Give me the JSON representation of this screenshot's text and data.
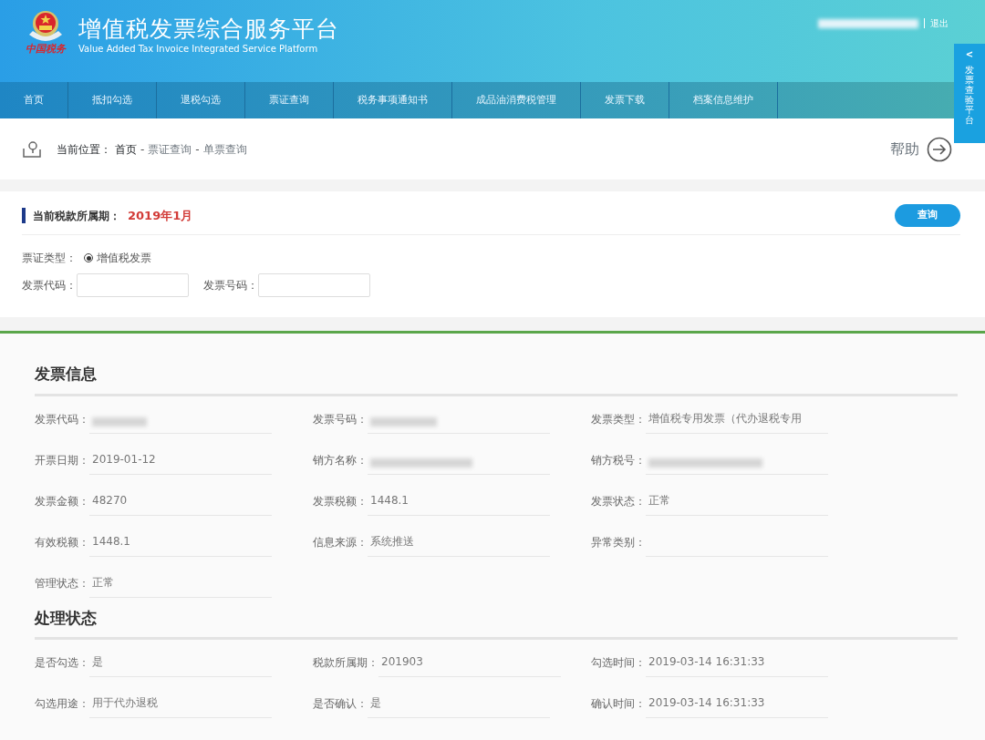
{
  "header": {
    "logo_text": "中国税务",
    "title": "增值税发票综合服务平台",
    "subtitle": "Value Added Tax Invoice Integrated Service Platform",
    "user_redacted": true,
    "logout": "退出"
  },
  "side_tab": {
    "arrow": "<",
    "label": "发票查验平台"
  },
  "nav": [
    {
      "label": "首页",
      "selected": false
    },
    {
      "label": "抵扣勾选",
      "selected": false
    },
    {
      "label": "退税勾选",
      "selected": false
    },
    {
      "label": "票证查询",
      "selected": false
    },
    {
      "label": "税务事项通知书",
      "selected": false
    },
    {
      "label": "成品油消费税管理",
      "selected": false
    },
    {
      "label": "发票下载",
      "selected": false
    },
    {
      "label": "档案信息维护",
      "selected": false
    }
  ],
  "breadcrumb": {
    "label": "当前位置：",
    "items": [
      "首页",
      "票证查询",
      "单票查询"
    ],
    "separator": "-"
  },
  "help": "帮助",
  "query": {
    "period_label": "当前税款所属期：",
    "period_value": "2019年1月",
    "search_button": "查询",
    "type_label": "票证类型：",
    "types": [
      {
        "label": "增值税发票",
        "selected": true
      }
    ],
    "fields": [
      {
        "label": "发票代码："
      },
      {
        "label": "发票号码："
      }
    ]
  },
  "sections": [
    {
      "title": "发票信息",
      "items": [
        {
          "label": "发票代码：",
          "redacted": true
        },
        {
          "label": "发票号码：",
          "redacted": true
        },
        {
          "label": "发票类型：",
          "value": "增值税专用发票（代办退税专用"
        },
        {
          "label": "开票日期：",
          "value": "2019-01-12"
        },
        {
          "label": "销方名称：",
          "redacted": true
        },
        {
          "label": "销方税号：",
          "redacted": true
        },
        {
          "label": "发票金额：",
          "value": "48270"
        },
        {
          "label": "发票税额：",
          "value": "1448.1"
        },
        {
          "label": "发票状态：",
          "value": "正常"
        },
        {
          "label": "有效税额：",
          "value": "1448.1"
        },
        {
          "label": "信息来源：",
          "value": "系统推送"
        },
        {
          "label": "异常类别："
        },
        {
          "label": "管理状态：",
          "value": "正常"
        }
      ]
    },
    {
      "title": "处理状态",
      "items": [
        {
          "label": "是否勾选：",
          "value": "是"
        },
        {
          "label": "税款所属期：",
          "value": "201903"
        },
        {
          "label": "勾选时间：",
          "value": "2019-03-14 16:31:33"
        },
        {
          "label": "勾选用途：",
          "value": "用于代办退税"
        },
        {
          "label": "是否确认：",
          "value": "是"
        },
        {
          "label": "确认时间：",
          "value": "2019-03-14 16:31:33"
        }
      ]
    }
  ]
}
